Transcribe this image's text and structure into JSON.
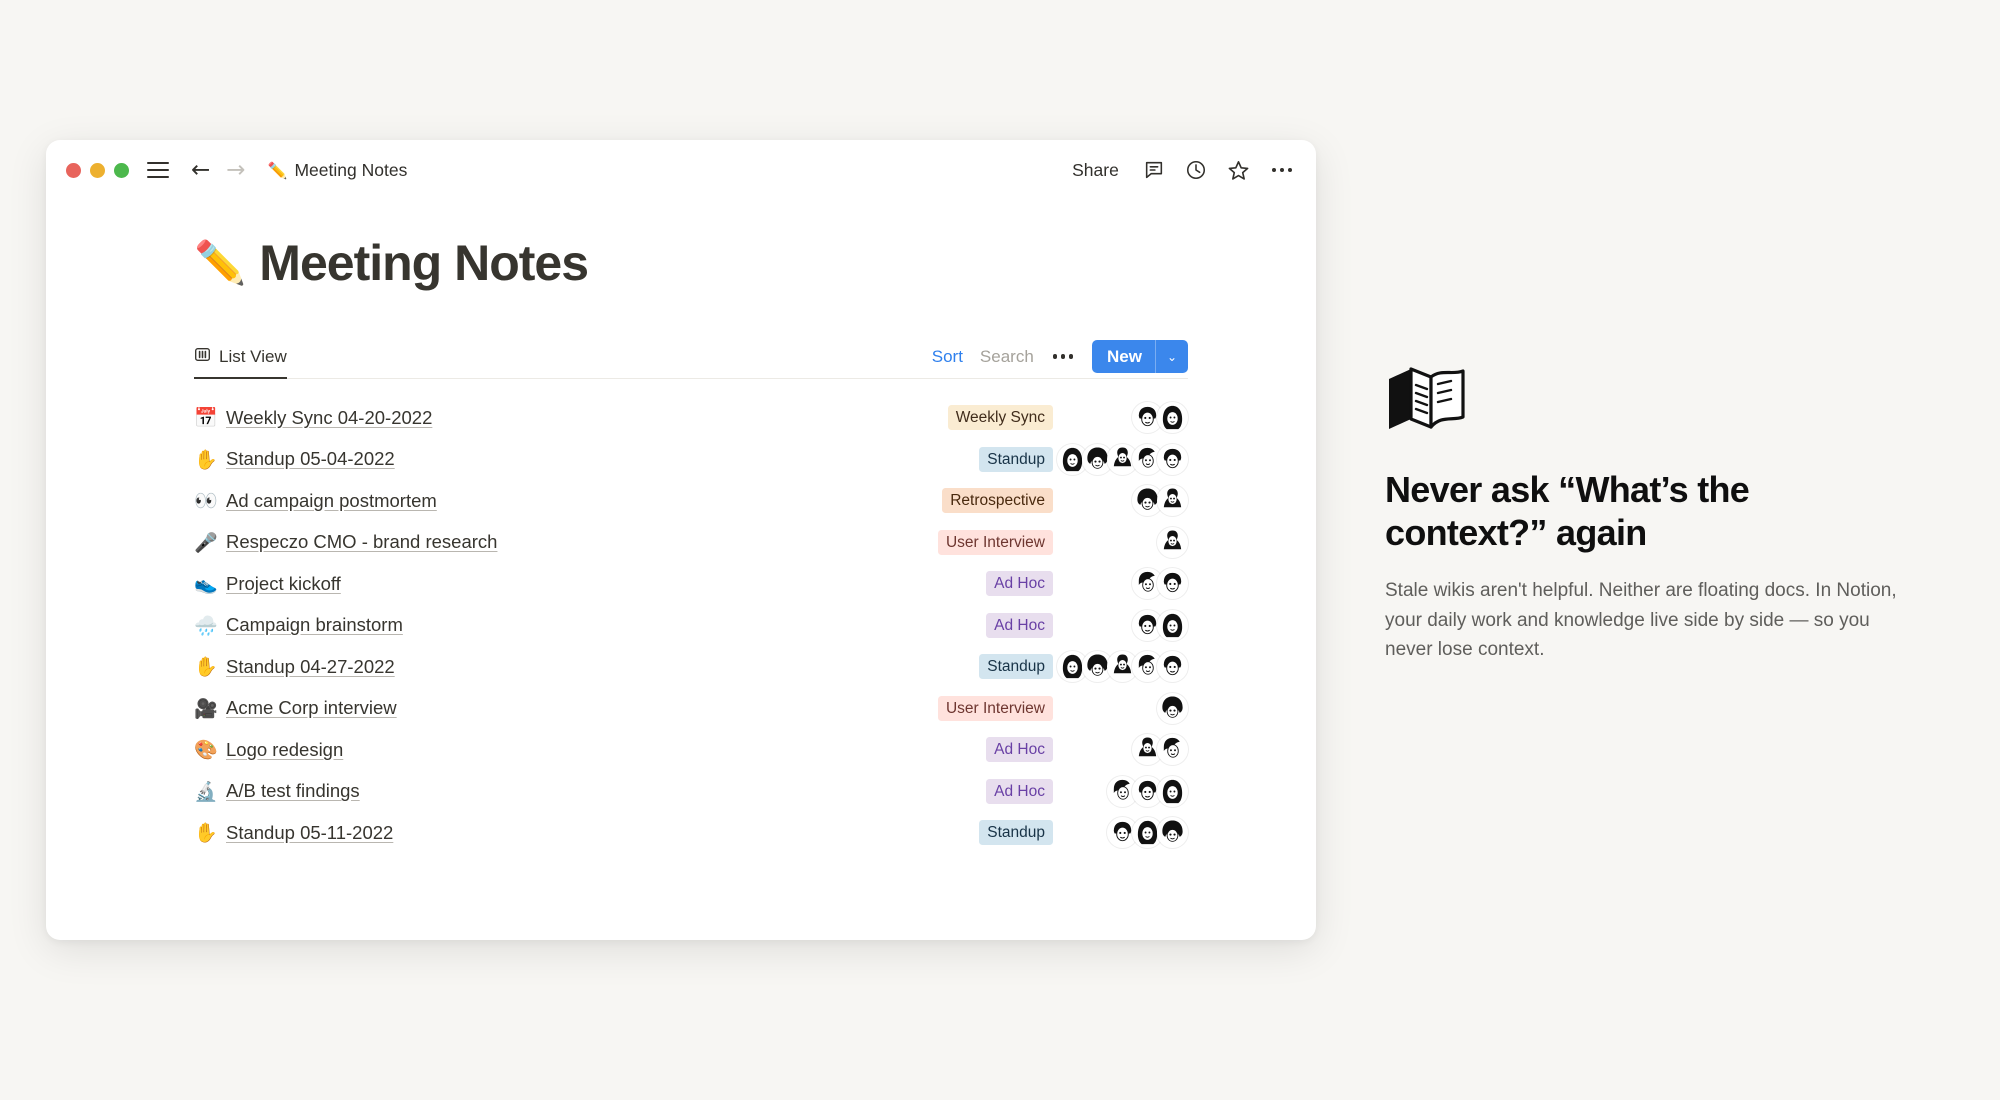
{
  "window": {
    "titlebar": {
      "traffic_lights": [
        "close",
        "minimize",
        "maximize"
      ],
      "menu_icon": "hamburger-icon",
      "back_arrow": "←",
      "forward_arrow": "→",
      "breadcrumb_emoji": "✏️",
      "breadcrumb_label": "Meeting Notes",
      "share_label": "Share",
      "icons": [
        "comment-icon",
        "history-icon",
        "favorite-star-icon",
        "more-options-icon"
      ]
    }
  },
  "page": {
    "title_emoji": "✏️",
    "title": "Meeting Notes"
  },
  "toolbar": {
    "view_tab_label": "List View",
    "view_tab_icon": "list-view-icon",
    "sort_label": "Sort",
    "search_label": "Search",
    "more_label": "more-options-icon",
    "new_label": "New",
    "new_chevron": "⌄"
  },
  "colors": {
    "accent_blue": "#3b87ec",
    "sort_blue": "#2f80ed",
    "search_gray": "#a5a29b",
    "window_bg": "#ffffff",
    "page_bg": "#f7f6f3",
    "tag_weekly_sync": "#faecd2",
    "tag_standup": "#d3e5ef",
    "tag_retrospective": "#fadec9",
    "tag_user_interview": "#ffe2dd",
    "tag_ad_hoc": "#e8deee"
  },
  "rows": [
    {
      "emoji": "📅",
      "title": "Weekly Sync 04-20-2022",
      "tag": "Weekly Sync",
      "tag_class": "tag-weekly-sync",
      "avatars": 2
    },
    {
      "emoji": "✋",
      "title": "Standup 05-04-2022",
      "tag": "Standup",
      "tag_class": "tag-standup",
      "avatars": 5
    },
    {
      "emoji": "👀",
      "title": "Ad campaign postmortem",
      "tag": "Retrospective",
      "tag_class": "tag-retrospective",
      "avatars": 2
    },
    {
      "emoji": "🎤",
      "title": "Respeczo CMO - brand research",
      "tag": "User Interview",
      "tag_class": "tag-user-interview",
      "avatars": 1
    },
    {
      "emoji": "👟",
      "title": "Project kickoff",
      "tag": "Ad Hoc",
      "tag_class": "tag-ad-hoc",
      "avatars": 2
    },
    {
      "emoji": "🌧️",
      "title": "Campaign brainstorm",
      "tag": "Ad Hoc",
      "tag_class": "tag-ad-hoc",
      "avatars": 2
    },
    {
      "emoji": "✋",
      "title": "Standup 04-27-2022",
      "tag": "Standup",
      "tag_class": "tag-standup",
      "avatars": 5
    },
    {
      "emoji": "🎥",
      "title": "Acme Corp interview",
      "tag": "User Interview",
      "tag_class": "tag-user-interview",
      "avatars": 1
    },
    {
      "emoji": "🎨",
      "title": "Logo redesign",
      "tag": "Ad Hoc",
      "tag_class": "tag-ad-hoc",
      "avatars": 2
    },
    {
      "emoji": "🔬",
      "title": "A/B test findings",
      "tag": "Ad Hoc",
      "tag_class": "tag-ad-hoc",
      "avatars": 3
    },
    {
      "emoji": "✋",
      "title": "Standup 05-11-2022",
      "tag": "Standup",
      "tag_class": "tag-standup",
      "avatars": 3
    }
  ],
  "promo": {
    "icon": "open-book-icon",
    "heading": "Never ask “What’s the context?” again",
    "body": "Stale wikis aren't helpful. Neither are floating docs. In Notion, your daily work and knowledge live side by side — so you never lose context."
  }
}
